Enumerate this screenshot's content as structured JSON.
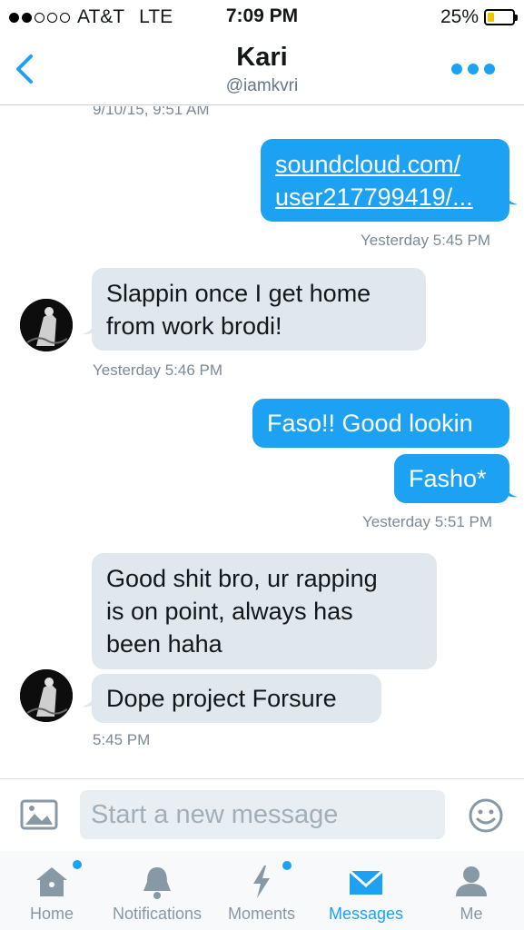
{
  "status_bar": {
    "carrier": "AT&T",
    "network": "LTE",
    "time": "7:09 PM",
    "battery": "25%",
    "battery_level": 0.25,
    "signal_bars_filled": 2,
    "signal_bars_total": 5
  },
  "header": {
    "name": "Kari",
    "handle": "@iamkvri",
    "back_icon": "chevron-left-icon",
    "more_icon": "more-dots-icon"
  },
  "conversation": {
    "top_timestamp": "9/10/15, 9:51 AM",
    "msg_link_line1": "soundcloud.com/",
    "msg_link_line2": "user217799419/...",
    "ts_1": "Yesterday 5:45 PM",
    "msg_in1_line1": "Slappin once I get home",
    "msg_in1_line2": "from work brodi!",
    "ts_2": "Yesterday 5:46 PM",
    "msg_out2": "Faso!! Good lookin",
    "msg_out3": "Fasho*",
    "ts_3": "Yesterday 5:51 PM",
    "msg_in2_line1": "Good shit bro, ur rapping",
    "msg_in2_line2": "is on point, always has",
    "msg_in2_line3": "been haha",
    "msg_in3": "Dope project Forsure",
    "ts_4": "5:45 PM"
  },
  "composer": {
    "placeholder": "Start a new message",
    "image_icon": "image-icon",
    "emoji_icon": "smiley-icon"
  },
  "tabs": [
    {
      "label": "Home",
      "icon": "home-icon",
      "badge": true
    },
    {
      "label": "Notifications",
      "icon": "bell-icon",
      "badge": false
    },
    {
      "label": "Moments",
      "icon": "lightning-icon",
      "badge": true
    },
    {
      "label": "Messages",
      "icon": "envelope-icon",
      "badge": false,
      "active": true
    },
    {
      "label": "Me",
      "icon": "person-icon",
      "badge": false
    }
  ],
  "colors": {
    "accent": "#1da1f2",
    "incoming_bubble": "#e1e8ed",
    "battery": "#f5c400",
    "muted_text": "#657786"
  }
}
